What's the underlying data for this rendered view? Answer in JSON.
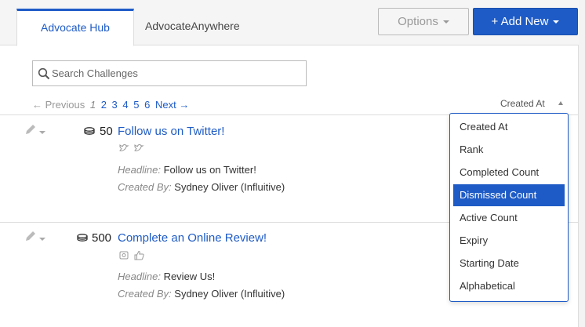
{
  "tabs": [
    {
      "label": "Advocate Hub",
      "active": true
    },
    {
      "label": "AdvocateAnywhere",
      "active": false
    }
  ],
  "toolbar": {
    "options_label": "Options",
    "add_label": "+ Add New"
  },
  "search": {
    "placeholder": "Search Challenges",
    "icon": "search-icon"
  },
  "pager": {
    "previous": "← Previous",
    "current": "1",
    "pages": [
      "2",
      "3",
      "4",
      "5",
      "6"
    ],
    "next": "Next →"
  },
  "sort": {
    "label": "Created At"
  },
  "challenges": [
    {
      "points": "50",
      "title": "Follow us on Twitter!",
      "headline_key": "Headline:",
      "headline": "Follow us on Twitter!",
      "created_by_key": "Created By:",
      "created_by": "Sydney Oliver (Influitive)"
    },
    {
      "points": "500",
      "title": "Complete an Online Review!",
      "headline_key": "Headline:",
      "headline": "Review Us!",
      "created_by_key": "Created By:",
      "created_by": "Sydney Oliver (Influitive)"
    }
  ],
  "sort_options": [
    {
      "label": "Created At",
      "selected": false
    },
    {
      "label": "Rank",
      "selected": false
    },
    {
      "label": "Completed Count",
      "selected": false
    },
    {
      "label": "Dismissed Count",
      "selected": true
    },
    {
      "label": "Active Count",
      "selected": false
    },
    {
      "label": "Expiry",
      "selected": false
    },
    {
      "label": "Starting Date",
      "selected": false
    },
    {
      "label": "Alphabetical",
      "selected": false
    }
  ],
  "colors": {
    "accent": "#1e5bc6"
  }
}
